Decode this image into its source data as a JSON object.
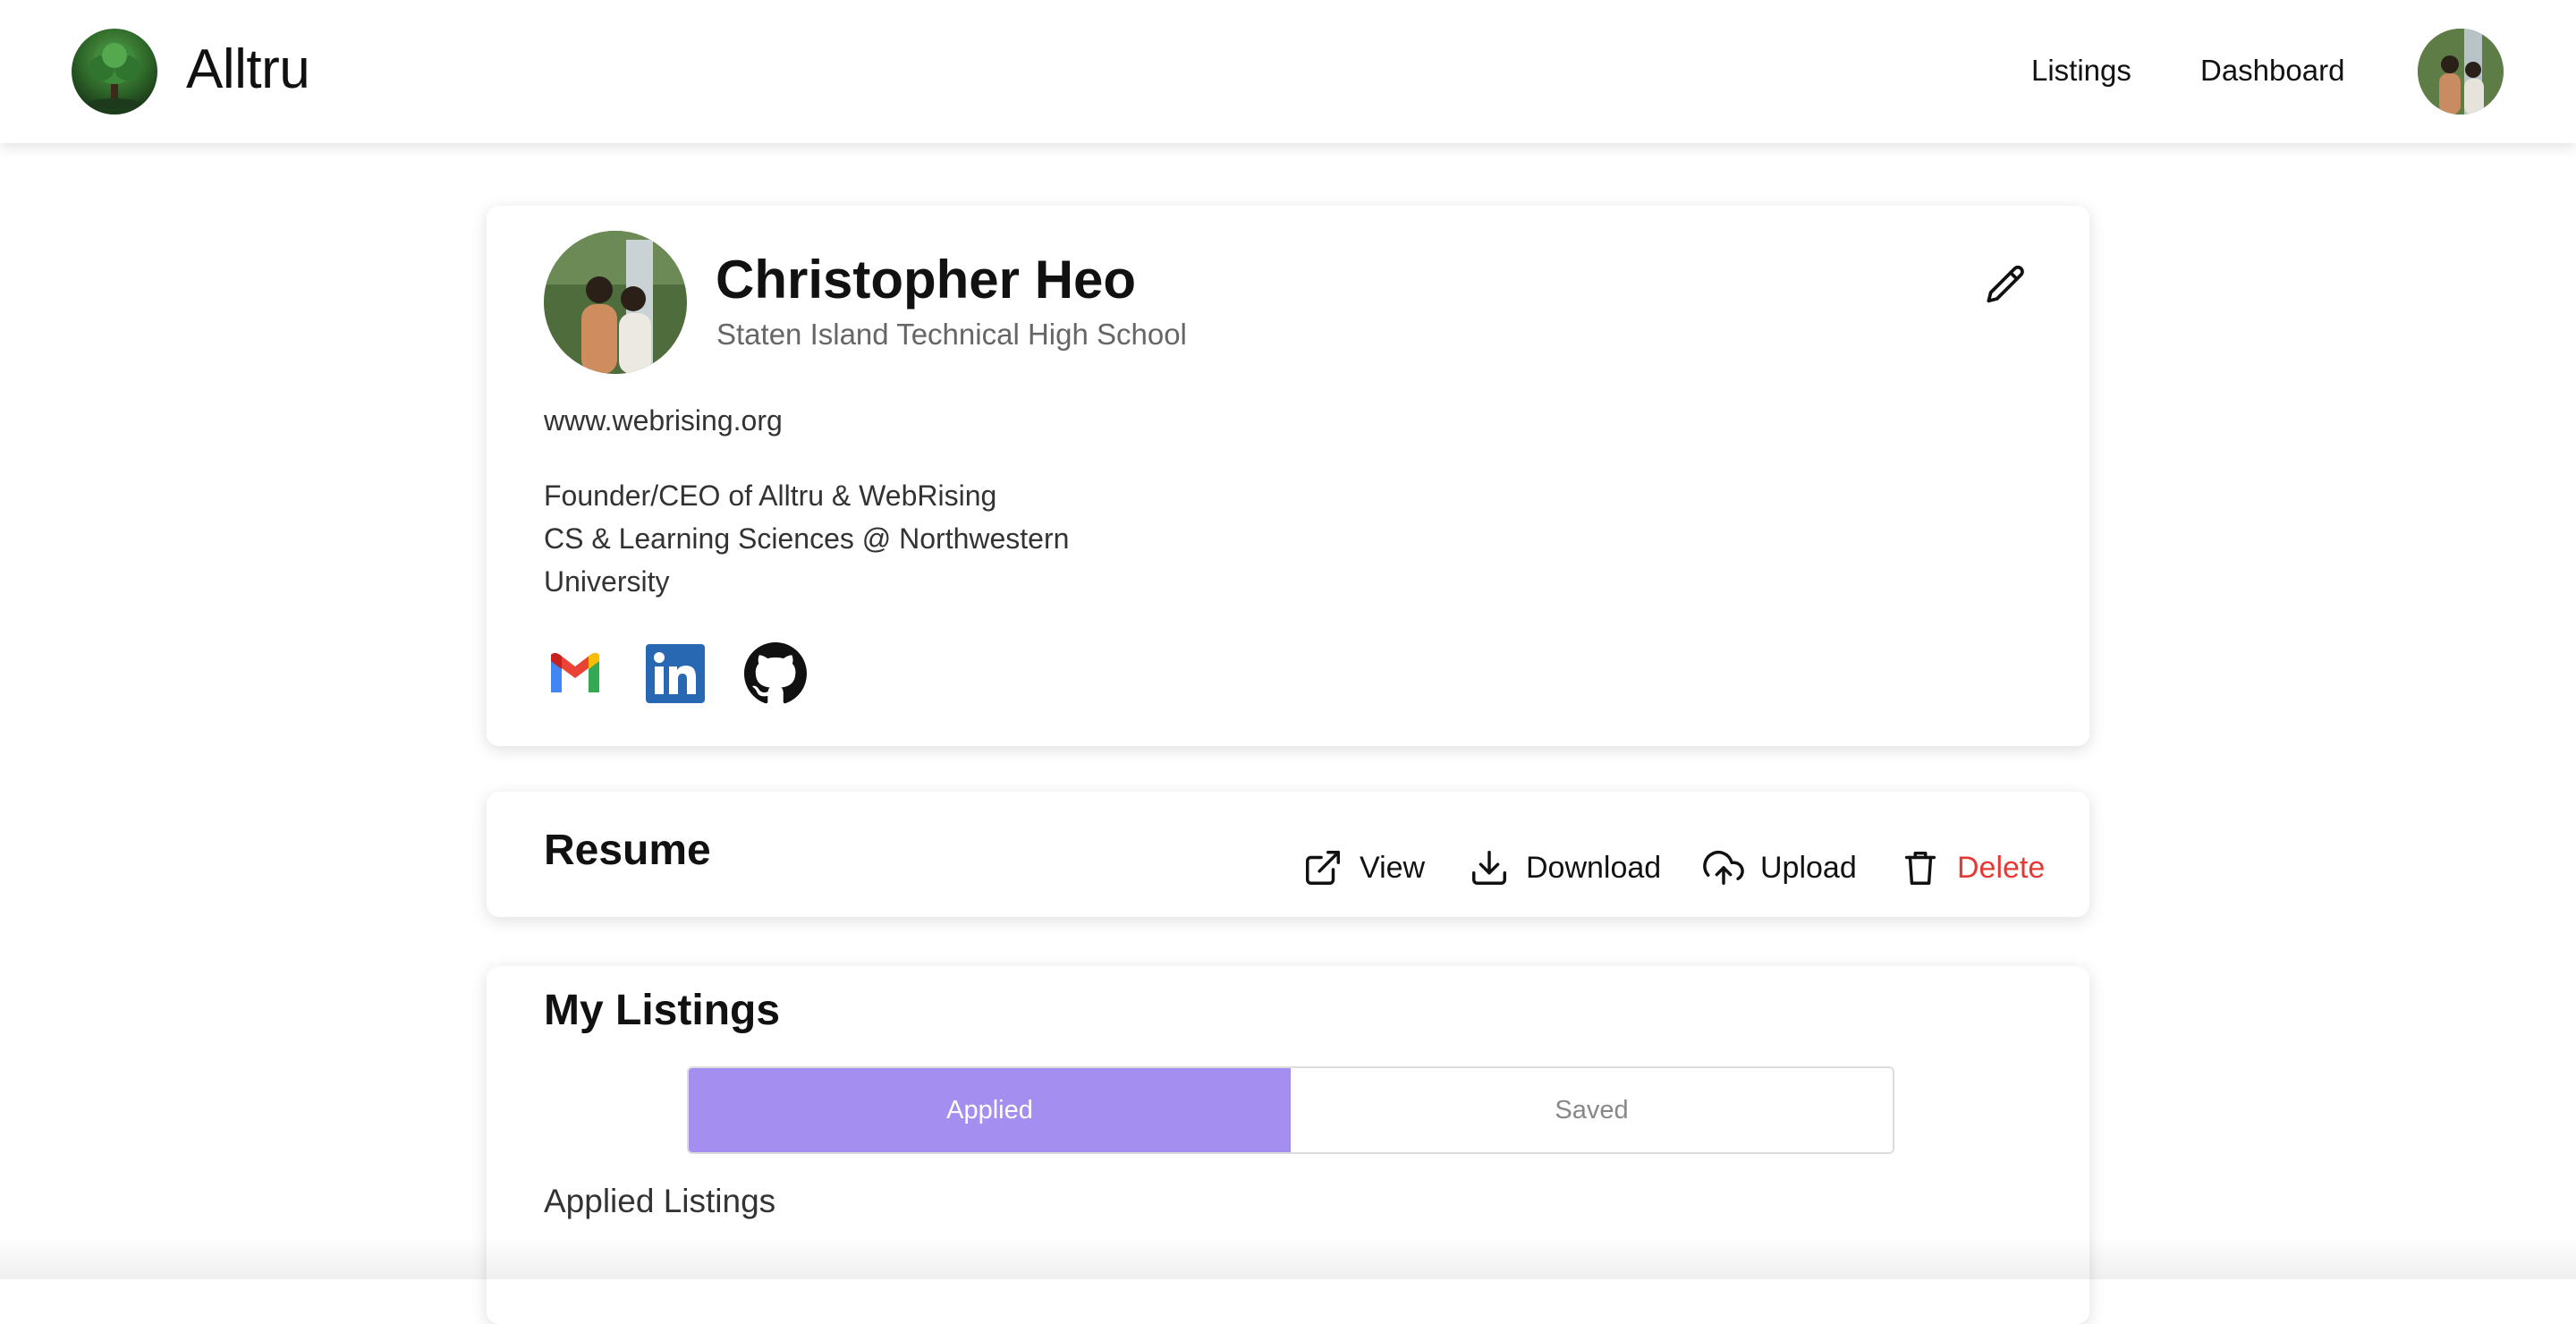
{
  "brand": {
    "name": "Alltru"
  },
  "nav": {
    "listings": "Listings",
    "dashboard": "Dashboard"
  },
  "profile": {
    "name": "Christopher Heo",
    "school": "Staten Island Technical High School",
    "website": "www.webrising.org",
    "bio_lines": [
      "Founder/CEO of Alltru & WebRising",
      "CS & Learning Sciences @ Northwestern",
      "University"
    ],
    "socials": [
      "gmail-icon",
      "linkedin-icon",
      "github-icon"
    ]
  },
  "resume": {
    "title": "Resume",
    "actions": {
      "view": "View",
      "download": "Download",
      "upload": "Upload",
      "delete": "Delete"
    }
  },
  "listings": {
    "title": "My Listings",
    "tabs": {
      "applied": "Applied",
      "saved": "Saved"
    },
    "active_tab": "Applied",
    "subtitle": "Applied Listings"
  },
  "colors": {
    "accent": "#a48ef0",
    "danger": "#e53935",
    "linkedin": "#2867b2"
  }
}
